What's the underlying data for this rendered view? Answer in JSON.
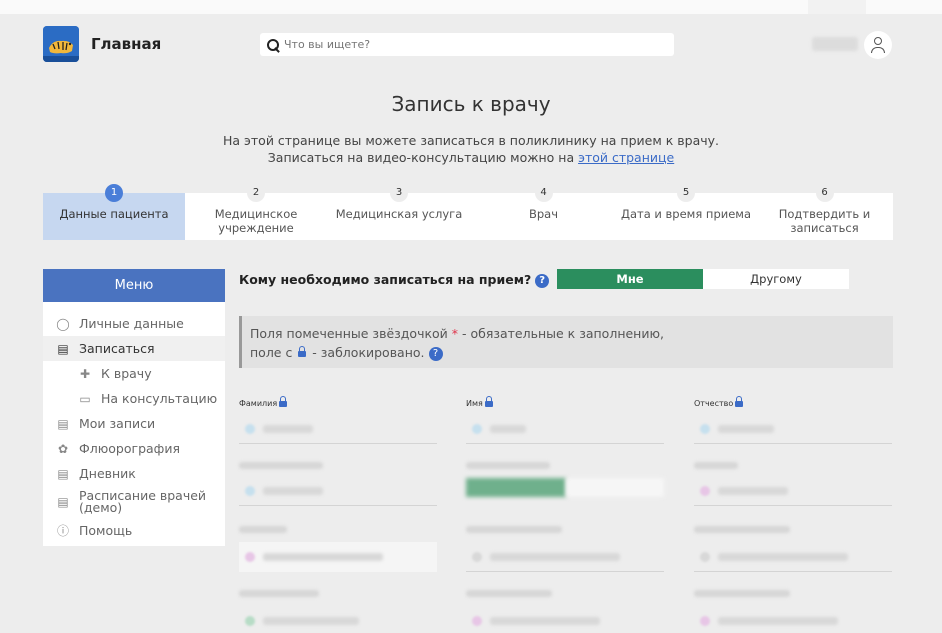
{
  "header": {
    "brand": "Главная",
    "search_placeholder": "Что вы ищете?"
  },
  "page": {
    "title": "Запись к врачу",
    "subtitle_line1": "На этой странице вы можете записаться в поликлинику на прием к врачу.",
    "subtitle_line2_prefix": "Записаться на видео-консультацию можно на ",
    "subtitle_link": "этой странице"
  },
  "steps": [
    {
      "num": "1",
      "label": "Данные пациента",
      "active": true
    },
    {
      "num": "2",
      "label": "Медицинское учреждение"
    },
    {
      "num": "3",
      "label": "Медицинская услуга"
    },
    {
      "num": "4",
      "label": "Врач"
    },
    {
      "num": "5",
      "label": "Дата и время приема"
    },
    {
      "num": "6",
      "label": "Подтвердить и записаться"
    }
  ],
  "menu": {
    "title": "Меню",
    "items": [
      {
        "label": "Личные данные",
        "icon": "person-icon"
      },
      {
        "label": "Записаться",
        "icon": "document-icon",
        "active": true
      },
      {
        "label": "К врачу",
        "icon": "cross-icon",
        "sub": true
      },
      {
        "label": "На консультацию",
        "icon": "video-icon",
        "sub": true
      },
      {
        "label": "Мои записи",
        "icon": "document-icon"
      },
      {
        "label": "Флюорография",
        "icon": "lungs-icon"
      },
      {
        "label": "Дневник",
        "icon": "notebook-icon"
      },
      {
        "label": "Расписание врачей (демо)",
        "icon": "notebook-icon"
      },
      {
        "label": "Помощь",
        "icon": "question-circle-icon"
      }
    ]
  },
  "form": {
    "question": "Кому необходимо записаться на прием?",
    "help_glyph": "?",
    "toggle_me": "Мне",
    "toggle_other": "Другому",
    "notice_line1_a": "Поля помеченные звёздочкой ",
    "notice_star": "*",
    "notice_line1_b": " - обязательные к заполнению,",
    "notice_line2_a": "поле с ",
    "notice_line2_b": " - заблокировано.",
    "label_lastname": "Фамилия",
    "label_firstname": "Имя",
    "label_patronymic": "Отчество"
  },
  "colors": {
    "accent_blue": "#4a73c0",
    "active_step_bg": "#c6d7f0",
    "toggle_green": "#2b8e5e",
    "required_red": "#e0334a"
  }
}
